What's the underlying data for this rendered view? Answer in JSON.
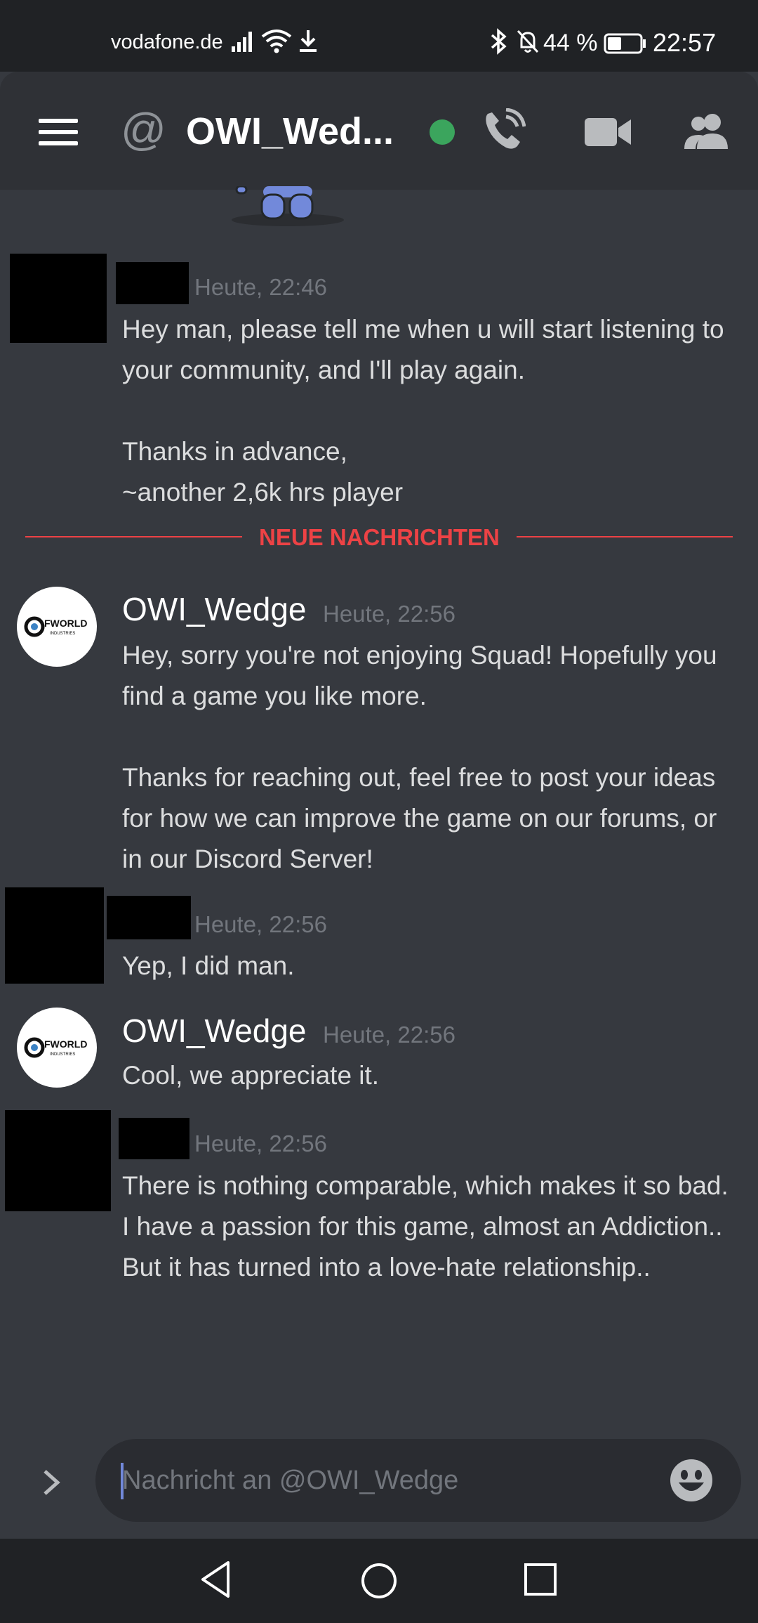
{
  "status_bar": {
    "carrier": "vodafone.de",
    "battery_pct": "44 %",
    "battery_level": 0.44,
    "time": "22:57",
    "icons": [
      "signal-icon",
      "wifi-icon",
      "download-icon",
      "bluetooth-icon",
      "bell-muted-icon",
      "battery-icon"
    ]
  },
  "header": {
    "at_symbol": "@",
    "title": "OWI_Wed...",
    "status": "online",
    "status_color": "#3ba55d",
    "icons": [
      "menu-icon",
      "voice-call-icon",
      "video-call-icon",
      "members-icon"
    ]
  },
  "messages": [
    {
      "author": "",
      "redacted": true,
      "time": "Heute, 22:46",
      "text": "Hey man, please tell me when u will start listening to your community, and I'll play again.\n\n Thanks in advance,\n~another 2,6k hrs player"
    },
    {
      "author": "OWI_Wedge",
      "avatar_text": "FWORLD",
      "avatar_subtext": "INDUSTRIES",
      "time": "Heute, 22:56",
      "text": "Hey, sorry you're not enjoying Squad! Hopefully you find a game you like more.\n\nThanks for reaching out, feel free to post your ideas for how we can improve the game on our forums, or in our Discord Server!"
    },
    {
      "author": "",
      "redacted": true,
      "time": "Heute, 22:56",
      "text": "Yep, I did man."
    },
    {
      "author": "OWI_Wedge",
      "avatar_text": "FWORLD",
      "avatar_subtext": "INDUSTRIES",
      "time": "Heute, 22:56",
      "text": "Cool, we appreciate it."
    },
    {
      "author": "",
      "redacted": true,
      "time": "Heute, 22:56",
      "text": "There is nothing comparable, which makes it so bad.\nI have a passion for this game, almost an Addiction..\nBut it has turned into a love-hate relationship.."
    }
  ],
  "new_messages_divider": "NEUE NACHRICHTEN",
  "divider_color": "#ed4245",
  "composer": {
    "placeholder": "Nachricht an @OWI_Wedge",
    "value": ""
  },
  "colors": {
    "background": "#36393f",
    "header": "#2f3136",
    "accent": "#7289da"
  }
}
